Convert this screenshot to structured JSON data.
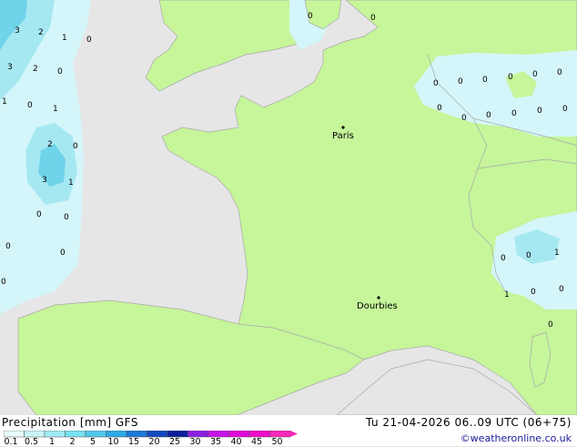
{
  "map": {
    "cities": [
      {
        "name": "Paris",
        "id": "paris"
      },
      {
        "name": "Dourbies",
        "id": "dourbies"
      }
    ],
    "precip_labels": [
      "3",
      "2",
      "1",
      "0",
      "3",
      "2",
      "0",
      "1",
      "0",
      "1",
      "2",
      "0",
      "3",
      "1",
      "0",
      "0",
      "0",
      "0",
      "0",
      "0",
      "0",
      "0",
      "0",
      "0",
      "0",
      "0",
      "0",
      "0",
      "0",
      "0",
      "0",
      "0",
      "0",
      "1",
      "0",
      "0",
      "1",
      "0",
      "0",
      "0"
    ],
    "colors": {
      "land": "#c6f59a",
      "sea": "#e6e6e6",
      "precip_light": "#d4f6fa",
      "precip_mid": "#a6e8f2",
      "precip_heavy": "#6fd3ea",
      "border": "#a8a8a8"
    }
  },
  "legend": {
    "title": "Precipitation [mm]  GFS",
    "datetime": "Tu 21-04-2026 06..09 UTC (06+75)",
    "credit": "©weatheronline.co.uk",
    "scale": [
      "0.1",
      "0.5",
      "1",
      "2",
      "5",
      "10",
      "15",
      "20",
      "25",
      "30",
      "35",
      "40",
      "45",
      "50"
    ],
    "scale_colors": [
      "#e8fcfc",
      "#c8f4f8",
      "#a0ecf4",
      "#78e0f0",
      "#50c8ec",
      "#2ca8e4",
      "#1e78d8",
      "#1448c0",
      "#0c1e9c",
      "#8c1ee0",
      "#c814e8",
      "#e00ad8",
      "#f00cc8",
      "#f828b8"
    ]
  }
}
